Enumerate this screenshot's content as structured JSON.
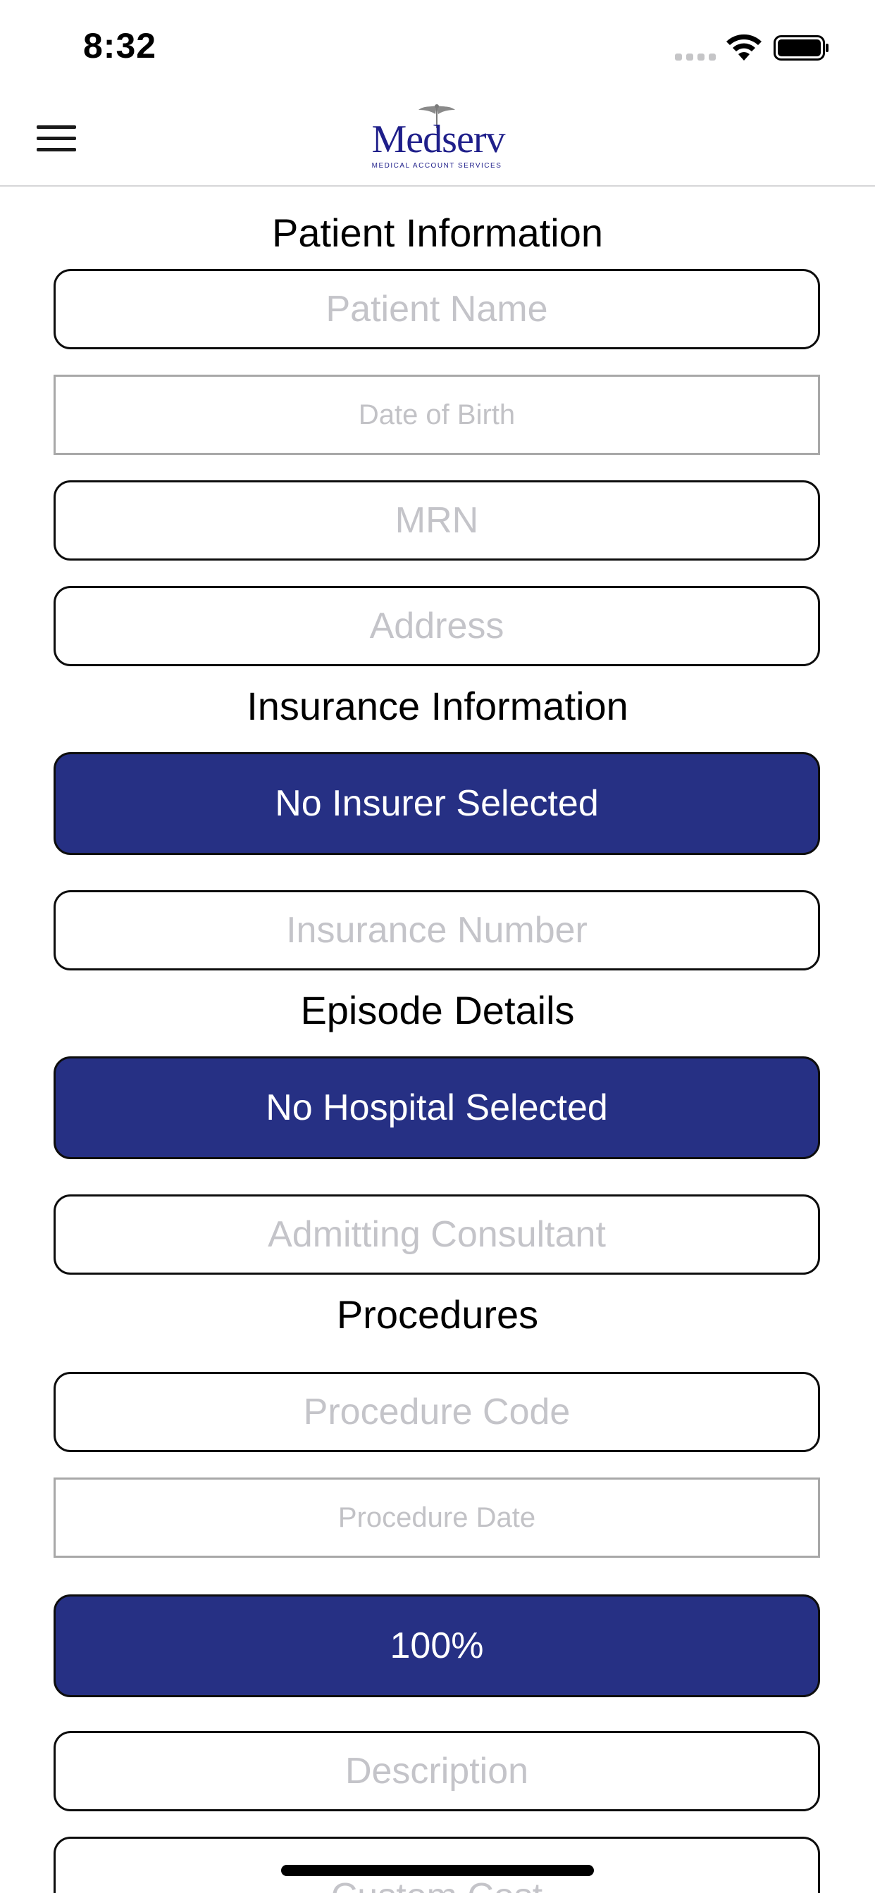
{
  "status_bar": {
    "time": "8:32"
  },
  "nav": {
    "logo_name": "Medserv",
    "logo_tagline": "MEDICAL ACCOUNT SERVICES",
    "brand_color": "#1f1f8a"
  },
  "patient_information": {
    "heading": "Patient Information",
    "patient_name_placeholder": "Patient Name",
    "date_of_birth_placeholder": "Date of Birth",
    "mrn_placeholder": "MRN",
    "address_placeholder": "Address"
  },
  "insurance_information": {
    "heading": "Insurance Information",
    "insurer_select_label": "No Insurer Selected",
    "insurance_number_placeholder": "Insurance Number"
  },
  "episode_details": {
    "heading": "Episode Details",
    "hospital_select_label": "No Hospital Selected",
    "admitting_consultant_placeholder": "Admitting Consultant"
  },
  "procedures": {
    "heading": "Procedures",
    "procedure_code_placeholder": "Procedure Code",
    "procedure_date_placeholder": "Procedure Date",
    "percentage_select_label": "100%",
    "description_placeholder": "Description",
    "custom_cost_placeholder": "Custom Cost"
  },
  "colors": {
    "button_fill": "#263084",
    "placeholder_text": "#c4c4c9",
    "field_border": "#0d0d0d"
  }
}
